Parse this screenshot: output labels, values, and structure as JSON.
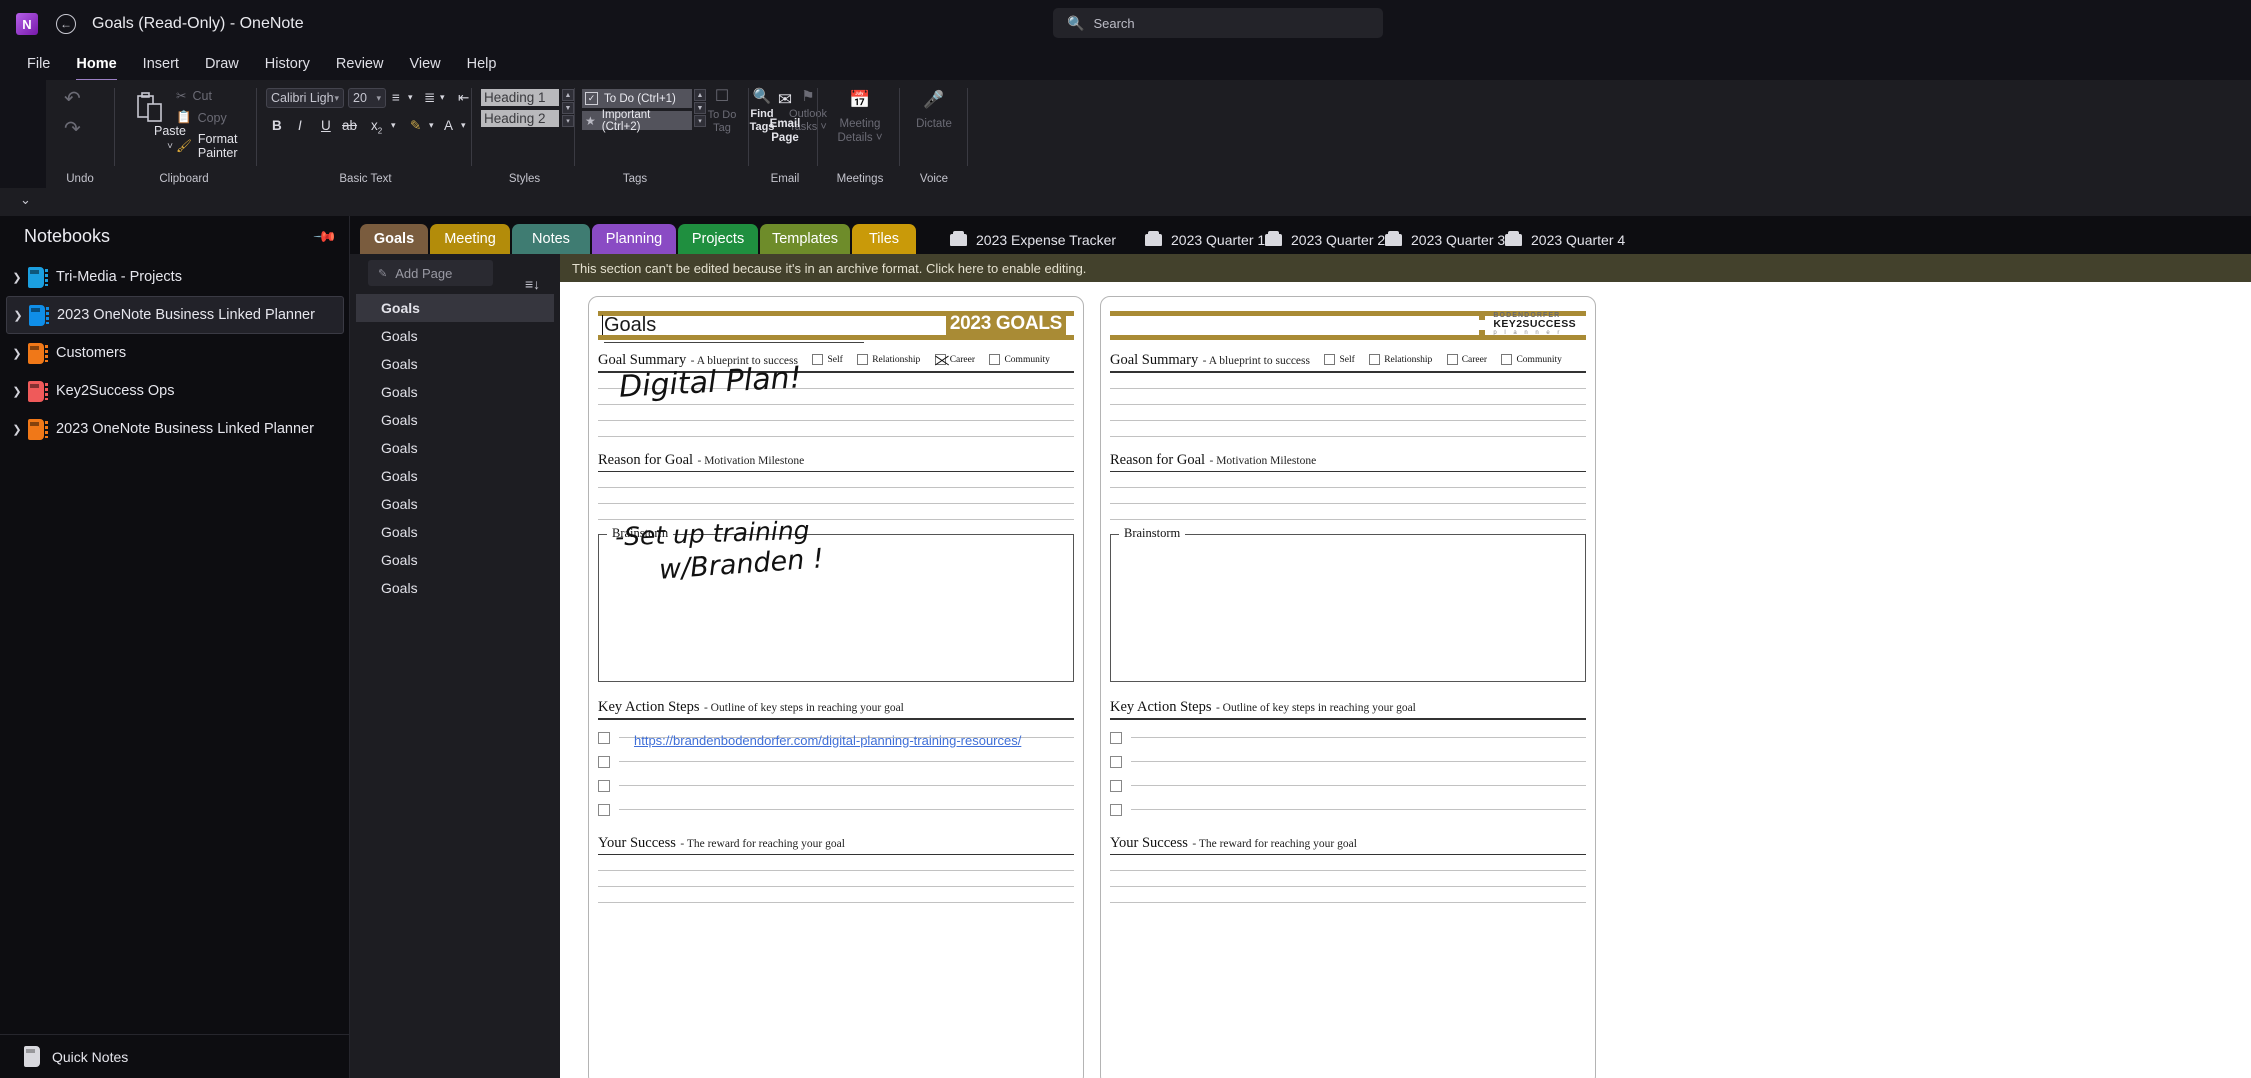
{
  "titlebar": {
    "app_initial": "N",
    "title": "Goals (Read-Only)  -  OneNote",
    "back_icon": "back-arrow-icon"
  },
  "search": {
    "placeholder": "Search",
    "icon": "search-icon"
  },
  "menubar": {
    "items": [
      {
        "label": "File",
        "active": false
      },
      {
        "label": "Home",
        "active": true
      },
      {
        "label": "Insert",
        "active": false
      },
      {
        "label": "Draw",
        "active": false
      },
      {
        "label": "History",
        "active": false
      },
      {
        "label": "Review",
        "active": false
      },
      {
        "label": "View",
        "active": false
      },
      {
        "label": "Help",
        "active": false
      }
    ]
  },
  "ribbon": {
    "groups": {
      "undo": {
        "label": "Undo",
        "undo_icon": "undo-arrow-icon",
        "redo_icon": "redo-arrow-icon"
      },
      "clipboard": {
        "label": "Clipboard",
        "paste": "Paste",
        "paste_caret": "˅",
        "cut": "Cut",
        "copy": "Copy",
        "format_painter": "Format Painter"
      },
      "basic_text": {
        "label": "Basic Text",
        "font_name": "Calibri Light",
        "font_size": "20",
        "bold": "B",
        "italic": "I",
        "underline": "U",
        "strikethrough": "ab",
        "subscript": "x",
        "subscript_sub": "2"
      },
      "styles": {
        "label": "Styles",
        "items": [
          "Heading 1",
          "Heading 2"
        ]
      },
      "tags": {
        "label": "Tags",
        "items": [
          {
            "label": "To Do (Ctrl+1)",
            "icon": "checkmark-icon"
          },
          {
            "label": "Important (Ctrl+2)",
            "icon": "star-icon"
          }
        ],
        "buttons": [
          {
            "label": "To Do\nTag",
            "icon": "todo-tag-icon",
            "enabled": false
          },
          {
            "label": "Find\nTags",
            "icon": "find-tags-icon",
            "enabled": true
          },
          {
            "label": "Outlook\nTasks ˅",
            "icon": "flag-icon",
            "enabled": false
          }
        ]
      },
      "email": {
        "label": "Email",
        "button": "Email\nPage",
        "icon": "envelope-icon"
      },
      "meetings": {
        "label": "Meetings",
        "button": "Meeting\nDetails ˅",
        "icon": "calendar-icon"
      },
      "voice": {
        "label": "Voice",
        "button": "Dictate",
        "icon": "microphone-icon"
      }
    },
    "collapse_icon": "collapse-ribbon-caret"
  },
  "sidebar": {
    "title": "Notebooks",
    "pin_icon": "pin-icon",
    "notebooks": [
      {
        "label": "Tri-Media - Projects",
        "color": "#1b9fe0",
        "selected": false,
        "warning": true
      },
      {
        "label": "2023 OneNote Business Linked Planner",
        "color": "#0f8ee8",
        "selected": true,
        "warning": false
      },
      {
        "label": "Customers",
        "color": "#f07818",
        "selected": false,
        "warning": false
      },
      {
        "label": "Key2Success Ops",
        "color": "#ef5a5a",
        "selected": false,
        "warning": false
      },
      {
        "label": "2023 OneNote Business Linked Planner",
        "color": "#f07818",
        "selected": false,
        "warning": false
      }
    ],
    "quick_notes": {
      "label": "Quick Notes",
      "icon": "notebook-icon"
    }
  },
  "section_tabs": [
    {
      "label": "Goals",
      "color": "#7a5c3e",
      "active": true
    },
    {
      "label": "Meeting",
      "color": "#b38c0a",
      "active": false
    },
    {
      "label": "Notes",
      "color": "#3f7c72",
      "active": false
    },
    {
      "label": "Planning",
      "color": "#8a4bc4",
      "active": false
    },
    {
      "label": "Projects",
      "color": "#1f8f3f",
      "active": false
    },
    {
      "label": "Templates",
      "color": "#6e8c2a",
      "active": false
    },
    {
      "label": "Tiles",
      "color": "#c99a09",
      "active": false
    }
  ],
  "archive_tabs": [
    {
      "label": "2023 Expense Tracker"
    },
    {
      "label": "2023 Quarter 1"
    },
    {
      "label": "2023 Quarter 2"
    },
    {
      "label": "2023 Quarter 3"
    },
    {
      "label": "2023 Quarter 4"
    }
  ],
  "archive_banner": {
    "text": "This section can't be edited because it's in an archive format. Click here to enable editing."
  },
  "page_list": {
    "add_page": "Add Page",
    "add_page_icon": "add-page-icon",
    "sort_icon": "sort-icon",
    "pages": [
      {
        "label": "Goals",
        "selected": true
      },
      {
        "label": "Goals",
        "selected": false
      },
      {
        "label": "Goals",
        "selected": false
      },
      {
        "label": "Goals",
        "selected": false
      },
      {
        "label": "Goals",
        "selected": false
      },
      {
        "label": "Goals",
        "selected": false
      },
      {
        "label": "Goals",
        "selected": false
      },
      {
        "label": "Goals",
        "selected": false
      },
      {
        "label": "Goals",
        "selected": false
      },
      {
        "label": "Goals",
        "selected": false
      },
      {
        "label": "Goals",
        "selected": false
      }
    ]
  },
  "planner": {
    "left_page": {
      "title": "Goals",
      "badge": "2023 GOALS",
      "goal_summary": {
        "title": "Goal Summary",
        "subtitle": "- A blueprint to success",
        "checkboxes": [
          {
            "label": "Self",
            "checked": false
          },
          {
            "label": "Relationship",
            "checked": false
          },
          {
            "label": "Career",
            "checked": true
          },
          {
            "label": "Community",
            "checked": false
          }
        ]
      },
      "ink_summary": "Digital Plan!",
      "reason": {
        "title": "Reason for Goal",
        "subtitle": "- Motivation Milestone"
      },
      "brainstorm": {
        "label": "Brainstorm",
        "ink_line1": "-Set up training",
        "ink_line2": "w/Branden !"
      },
      "key_action": {
        "title": "Key Action Steps",
        "subtitle": "- Outline of key steps in reaching your goal",
        "link": "https://brandenbodendorfer.com/digital-planning-training-resources/"
      },
      "success": {
        "title": "Your Success",
        "subtitle": "- The reward for reaching your goal"
      }
    },
    "right_page": {
      "brand": {
        "line1": "BODENDORFER",
        "line2": "KEY2SUCCESS",
        "line3": "p l a n n e r"
      },
      "goal_summary": {
        "title": "Goal Summary",
        "subtitle": "- A blueprint to success",
        "checkboxes": [
          {
            "label": "Self",
            "checked": false
          },
          {
            "label": "Relationship",
            "checked": false
          },
          {
            "label": "Career",
            "checked": false
          },
          {
            "label": "Community",
            "checked": false
          }
        ]
      },
      "reason": {
        "title": "Reason for Goal",
        "subtitle": "- Motivation Milestone"
      },
      "brainstorm": {
        "label": "Brainstorm"
      },
      "key_action": {
        "title": "Key Action Steps",
        "subtitle": "- Outline of key steps in reaching your goal"
      },
      "success": {
        "title": "Your Success",
        "subtitle": "- The reward for reaching your goal"
      }
    }
  }
}
